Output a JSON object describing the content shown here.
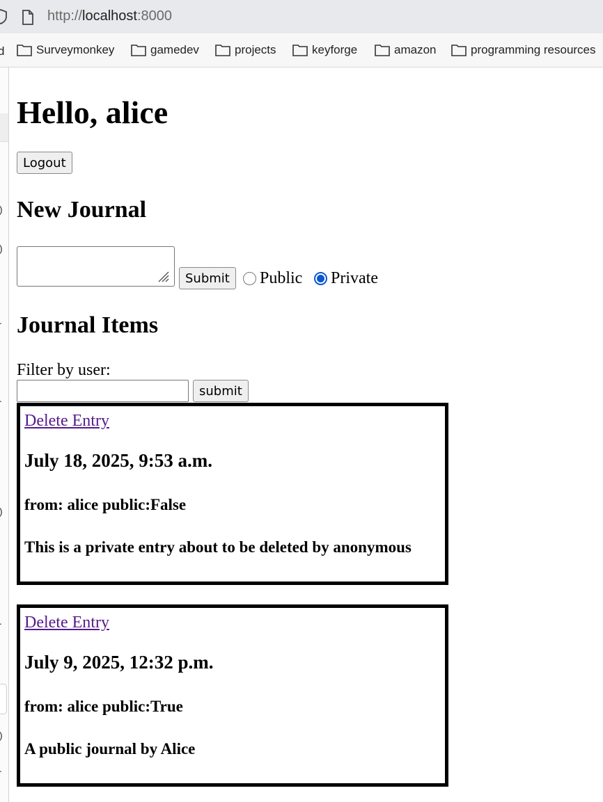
{
  "browser": {
    "url_scheme": "http://",
    "url_host": "localhost",
    "url_port": ":8000",
    "bookmarks_cut": "d",
    "bookmarks": [
      "Surveymonkey",
      "gamedev",
      "projects",
      "keyforge",
      "amazon",
      "programming resources"
    ]
  },
  "page": {
    "greeting": "Hello, alice",
    "logout_label": "Logout",
    "new_journal_heading": "New Journal",
    "submit_label": "Submit",
    "radio_public": "Public",
    "radio_private": "Private",
    "selected_visibility": "Private",
    "journal_items_heading": "Journal Items",
    "filter_label": "Filter by user:",
    "filter_submit_label": "submit",
    "entries": [
      {
        "delete_label": "Delete Entry",
        "date": "July 18, 2025, 9:53 a.m.",
        "from": "from: alice public:False",
        "text": "This is a private entry about to be deleted by anonymous"
      },
      {
        "delete_label": "Delete Entry",
        "date": "July 9, 2025, 12:32 p.m.",
        "from": "from: alice public:True",
        "text": "A public journal by Alice"
      }
    ]
  },
  "side_panel_marks": [
    ")",
    ")",
    ".",
    ".",
    ")",
    ".",
    ")",
    "."
  ],
  "icons": [
    "shield-icon",
    "page-icon",
    "folder-icon",
    "resize-grip-icon"
  ],
  "colors": {
    "link": "#551a8b",
    "radio_selected": "#0b57d0",
    "entry_border": "#000000"
  }
}
